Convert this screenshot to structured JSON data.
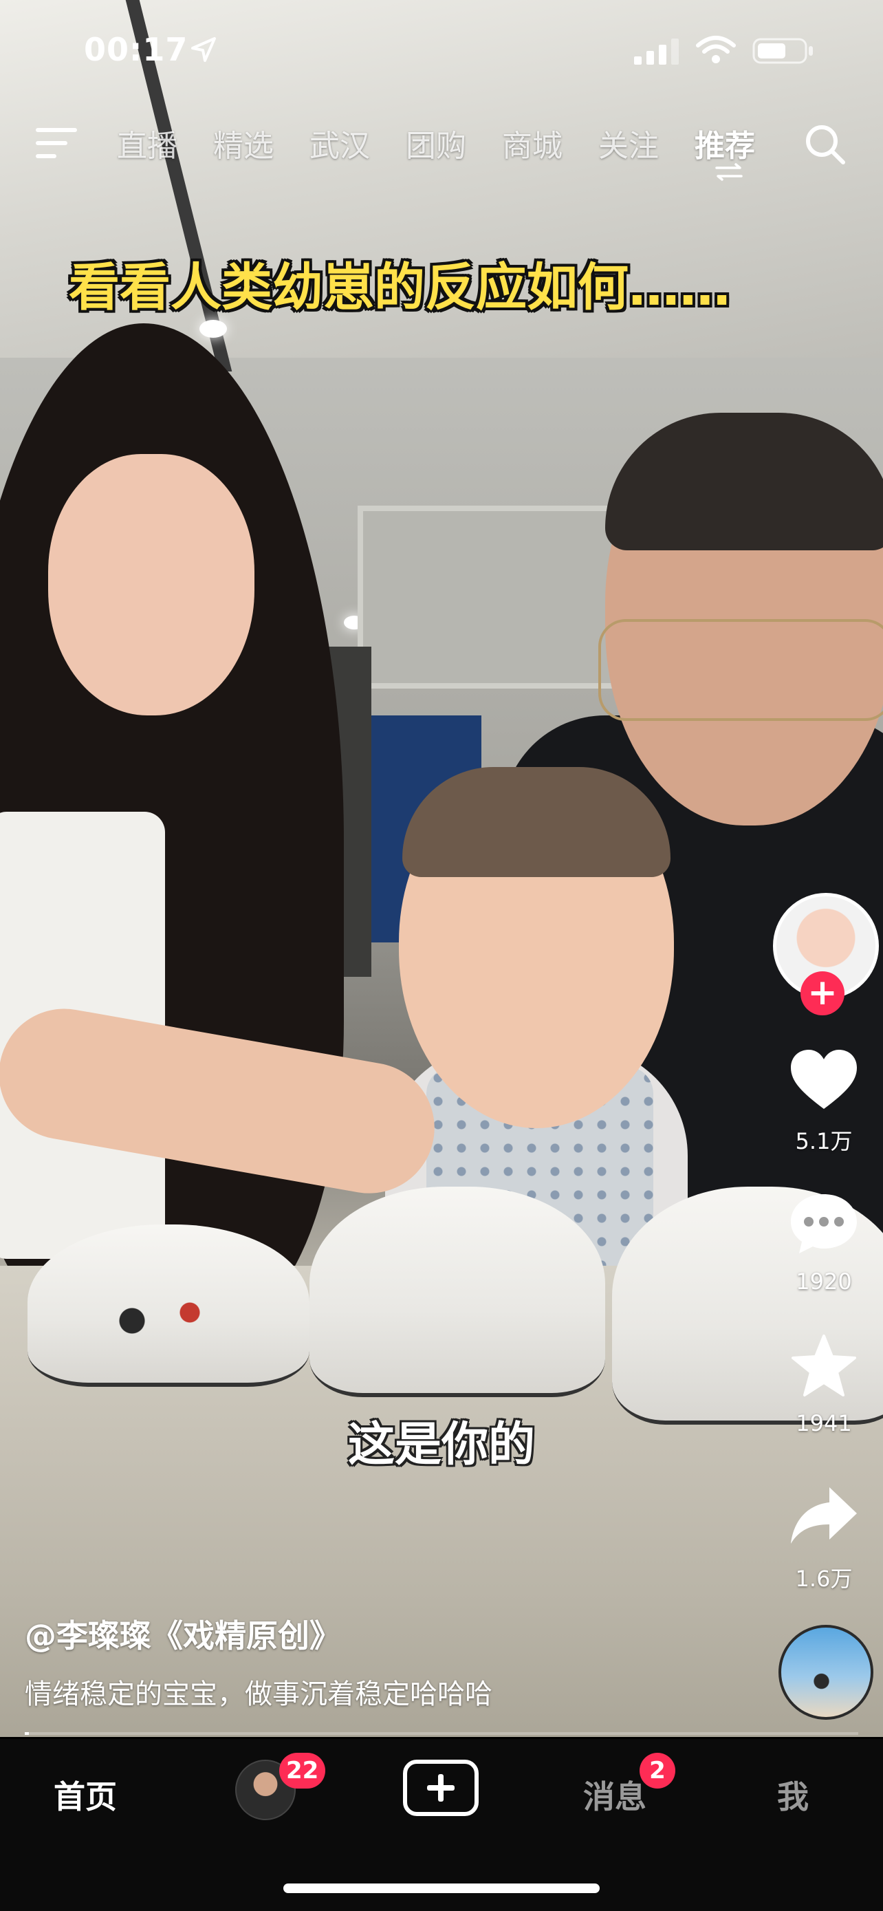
{
  "status_bar": {
    "time": "00:17"
  },
  "nav": {
    "tabs": [
      {
        "label": "直播"
      },
      {
        "label": "精选"
      },
      {
        "label": "武汉"
      },
      {
        "label": "团购"
      },
      {
        "label": "商城"
      },
      {
        "label": "关注"
      },
      {
        "label": "推荐"
      }
    ],
    "active_tab": "推荐"
  },
  "video": {
    "title_overlay": "看看人类幼崽的反应如何……",
    "subtitle": "这是你的",
    "progress_fraction": 0.005
  },
  "actions": {
    "like_count": "5.1万",
    "comment_count": "1920",
    "favorite_count": "1941",
    "share_count": "1.6万"
  },
  "post": {
    "author": "@李璨璨《戏精原创》",
    "description": "情绪稳定的宝宝，做事沉着稳定哈哈哈"
  },
  "tabbar": {
    "home": "首页",
    "friends_badge": "22",
    "messages": "消息",
    "messages_badge": "2",
    "me": "我"
  },
  "colors": {
    "accent": "#fe2c55",
    "title_yellow": "#ffe14a",
    "tabbar_bg": "#0b0b0b"
  },
  "icons": [
    "location-arrow-icon",
    "signal-icon",
    "wifi-icon",
    "battery-icon",
    "menu-icon",
    "switch-arrows-icon",
    "search-icon",
    "plus-icon",
    "heart-icon",
    "comment-icon",
    "star-icon",
    "share-icon",
    "music-disc-icon",
    "add-icon"
  ]
}
